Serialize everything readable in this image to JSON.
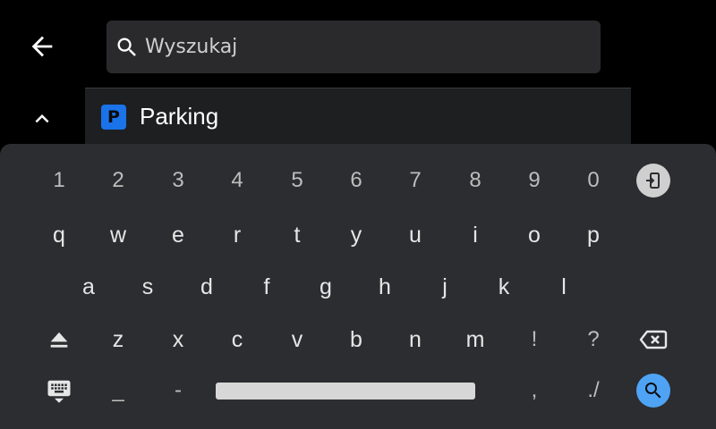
{
  "search": {
    "placeholder": "Wyszukaj"
  },
  "suggestion": {
    "label": "Parking",
    "icon": "parking-icon",
    "icon_letter": "P",
    "icon_color": "#1a73e8"
  },
  "keyboard": {
    "row1": [
      "1",
      "2",
      "3",
      "4",
      "5",
      "6",
      "7",
      "8",
      "9",
      "0"
    ],
    "row2": [
      "q",
      "w",
      "e",
      "r",
      "t",
      "y",
      "u",
      "i",
      "o",
      "p"
    ],
    "row3": [
      "a",
      "s",
      "d",
      "f",
      "g",
      "h",
      "j",
      "k",
      "l"
    ],
    "row4": [
      "z",
      "x",
      "c",
      "v",
      "b",
      "n",
      "m",
      "!",
      "?"
    ],
    "row5_left": [
      "_",
      "-"
    ],
    "row5_right": [
      ",",
      "./"
    ],
    "search_key_color": "#4ea3f5",
    "exit_key_color": "#cfcfcf"
  }
}
